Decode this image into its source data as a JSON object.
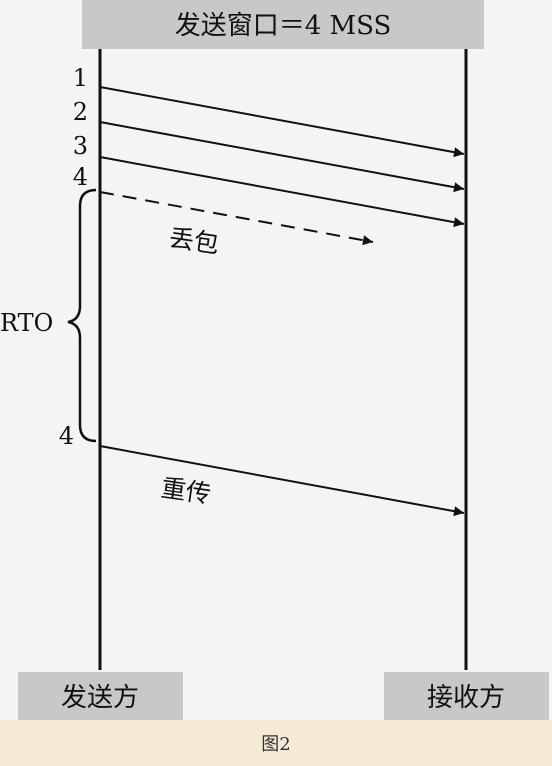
{
  "header": {
    "title": "发送窗口＝4 MSS"
  },
  "sender": {
    "label": "发送方"
  },
  "receiver": {
    "label": "接收方"
  },
  "segments": [
    {
      "number": "1",
      "status": "sent"
    },
    {
      "number": "2",
      "status": "sent"
    },
    {
      "number": "3",
      "status": "sent"
    },
    {
      "number": "4",
      "status": "lost"
    }
  ],
  "lost_label": "丢包",
  "timer": {
    "label": "RTO"
  },
  "retransmission": {
    "number": "4",
    "label": "重传"
  },
  "caption": "图2",
  "colors": {
    "header_bg": "#c8c8c8",
    "line": "#111111",
    "caption_bg": "#f5ead6"
  }
}
